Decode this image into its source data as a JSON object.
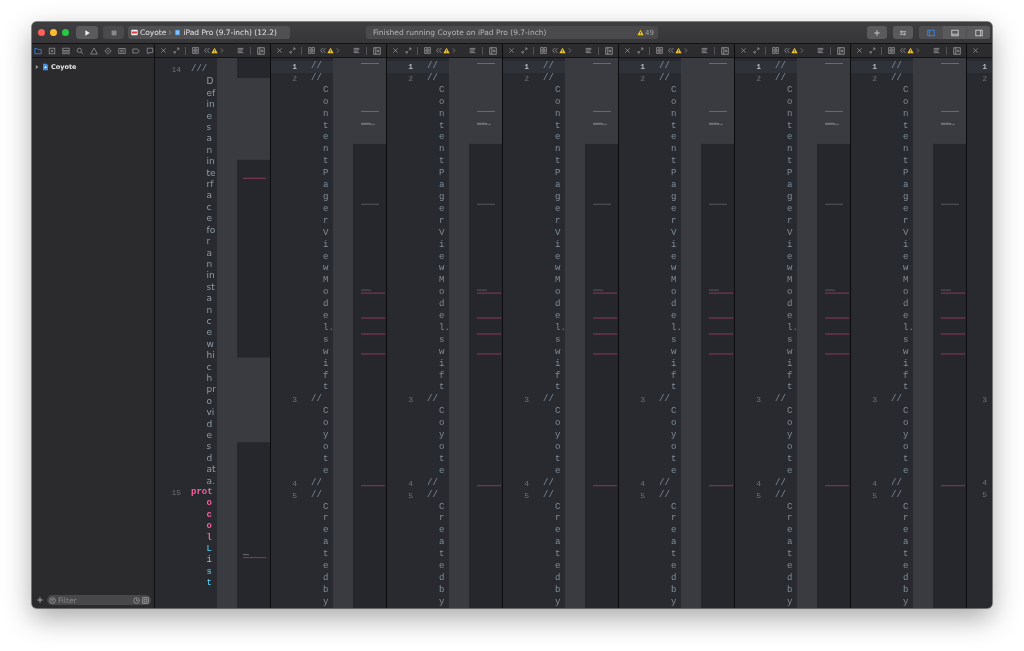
{
  "toolbar": {
    "scheme": "Coyote",
    "destination": "iPad Pro (9.7-inch) (12.2)",
    "activity": "Finished running Coyote on iPad Pro (9.7-inch)",
    "warning_count": "49",
    "layout_buttons": [
      {
        "kind": "navigator",
        "selected": true
      },
      {
        "kind": "debug",
        "selected": false
      },
      {
        "kind": "inspector",
        "selected": false
      }
    ]
  },
  "navigator": {
    "tabs": [
      {
        "kind": "project",
        "selected": true
      },
      {
        "kind": "source-control",
        "selected": false
      },
      {
        "kind": "symbols",
        "selected": false
      },
      {
        "kind": "find",
        "selected": false
      },
      {
        "kind": "issues",
        "selected": false
      },
      {
        "kind": "tests",
        "selected": false
      },
      {
        "kind": "debug",
        "selected": false
      },
      {
        "kind": "breakpoints",
        "selected": false
      },
      {
        "kind": "reports",
        "selected": false
      }
    ],
    "items": [
      {
        "label": "Coyote",
        "expanded": false
      }
    ],
    "filter": {
      "placeholder": "Filter"
    }
  },
  "editors": [
    {
      "kind": "primary",
      "lines": [
        {
          "number": "14",
          "current": false,
          "tokens": [
            {
              "kind": "comment",
              "text": "///"
            },
            {
              "kind": "doc",
              "text": " Defines an interface for an instance which provides data."
            }
          ]
        },
        {
          "number": "15",
          "current": false,
          "tokens": [
            {
              "kind": "keyword",
              "text": "protocol "
            },
            {
              "kind": "type",
              "text": "List"
            }
          ]
        }
      ]
    },
    {
      "kind": "source",
      "lines": [
        {
          "number": "1",
          "current": true,
          "tokens": [
            {
              "kind": "comment",
              "text": "//"
            }
          ]
        },
        {
          "number": "2",
          "current": false,
          "tokens": [
            {
              "kind": "comment",
              "text": "// ContentPagerViewModel.swift"
            }
          ]
        },
        {
          "number": "3",
          "current": false,
          "tokens": [
            {
              "kind": "comment",
              "text": "// Coyote"
            }
          ]
        },
        {
          "number": "4",
          "current": false,
          "tokens": [
            {
              "kind": "comment",
              "text": "//"
            }
          ]
        },
        {
          "number": "5",
          "current": false,
          "tokens": [
            {
              "kind": "comment",
              "text": "// Created by"
            }
          ]
        }
      ]
    },
    {
      "kind": "source",
      "lines": [
        {
          "number": "1",
          "current": true,
          "tokens": [
            {
              "kind": "comment",
              "text": "//"
            }
          ]
        },
        {
          "number": "2",
          "current": false,
          "tokens": [
            {
              "kind": "comment",
              "text": "// ContentPagerViewModel.swift"
            }
          ]
        },
        {
          "number": "3",
          "current": false,
          "tokens": [
            {
              "kind": "comment",
              "text": "// Coyote"
            }
          ]
        },
        {
          "number": "4",
          "current": false,
          "tokens": [
            {
              "kind": "comment",
              "text": "//"
            }
          ]
        },
        {
          "number": "5",
          "current": false,
          "tokens": [
            {
              "kind": "comment",
              "text": "// Created by"
            }
          ]
        }
      ]
    },
    {
      "kind": "source",
      "lines": [
        {
          "number": "1",
          "current": true,
          "tokens": [
            {
              "kind": "comment",
              "text": "//"
            }
          ]
        },
        {
          "number": "2",
          "current": false,
          "tokens": [
            {
              "kind": "comment",
              "text": "// ContentPagerViewModel.swift"
            }
          ]
        },
        {
          "number": "3",
          "current": false,
          "tokens": [
            {
              "kind": "comment",
              "text": "// Coyote"
            }
          ]
        },
        {
          "number": "4",
          "current": false,
          "tokens": [
            {
              "kind": "comment",
              "text": "//"
            }
          ]
        },
        {
          "number": "5",
          "current": false,
          "tokens": [
            {
              "kind": "comment",
              "text": "// Created by"
            }
          ]
        }
      ]
    },
    {
      "kind": "source",
      "lines": [
        {
          "number": "1",
          "current": true,
          "tokens": [
            {
              "kind": "comment",
              "text": "//"
            }
          ]
        },
        {
          "number": "2",
          "current": false,
          "tokens": [
            {
              "kind": "comment",
              "text": "// ContentPagerViewModel.swift"
            }
          ]
        },
        {
          "number": "3",
          "current": false,
          "tokens": [
            {
              "kind": "comment",
              "text": "// Coyote"
            }
          ]
        },
        {
          "number": "4",
          "current": false,
          "tokens": [
            {
              "kind": "comment",
              "text": "//"
            }
          ]
        },
        {
          "number": "5",
          "current": false,
          "tokens": [
            {
              "kind": "comment",
              "text": "// Created by"
            }
          ]
        }
      ]
    },
    {
      "kind": "source",
      "lines": [
        {
          "number": "1",
          "current": true,
          "tokens": [
            {
              "kind": "comment",
              "text": "//"
            }
          ]
        },
        {
          "number": "2",
          "current": false,
          "tokens": [
            {
              "kind": "comment",
              "text": "// ContentPagerViewModel.swift"
            }
          ]
        },
        {
          "number": "3",
          "current": false,
          "tokens": [
            {
              "kind": "comment",
              "text": "// Coyote"
            }
          ]
        },
        {
          "number": "4",
          "current": false,
          "tokens": [
            {
              "kind": "comment",
              "text": "//"
            }
          ]
        },
        {
          "number": "5",
          "current": false,
          "tokens": [
            {
              "kind": "comment",
              "text": "// Created by"
            }
          ]
        }
      ]
    },
    {
      "kind": "source",
      "lines": [
        {
          "number": "1",
          "current": true,
          "tokens": [
            {
              "kind": "comment",
              "text": "//"
            }
          ]
        },
        {
          "number": "2",
          "current": false,
          "tokens": [
            {
              "kind": "comment",
              "text": "// ContentPagerViewModel.swift"
            }
          ]
        },
        {
          "number": "3",
          "current": false,
          "tokens": [
            {
              "kind": "comment",
              "text": "// Coyote"
            }
          ]
        },
        {
          "number": "4",
          "current": false,
          "tokens": [
            {
              "kind": "comment",
              "text": "//"
            }
          ]
        },
        {
          "number": "5",
          "current": false,
          "tokens": [
            {
              "kind": "comment",
              "text": "// Created by"
            }
          ]
        }
      ]
    },
    {
      "kind": "edge",
      "lines": [
        {
          "number": "1",
          "current": true
        },
        {
          "number": "2",
          "current": false
        },
        {
          "number": "3",
          "current": false
        },
        {
          "number": "4",
          "current": false
        },
        {
          "number": "5",
          "current": false
        }
      ]
    }
  ]
}
